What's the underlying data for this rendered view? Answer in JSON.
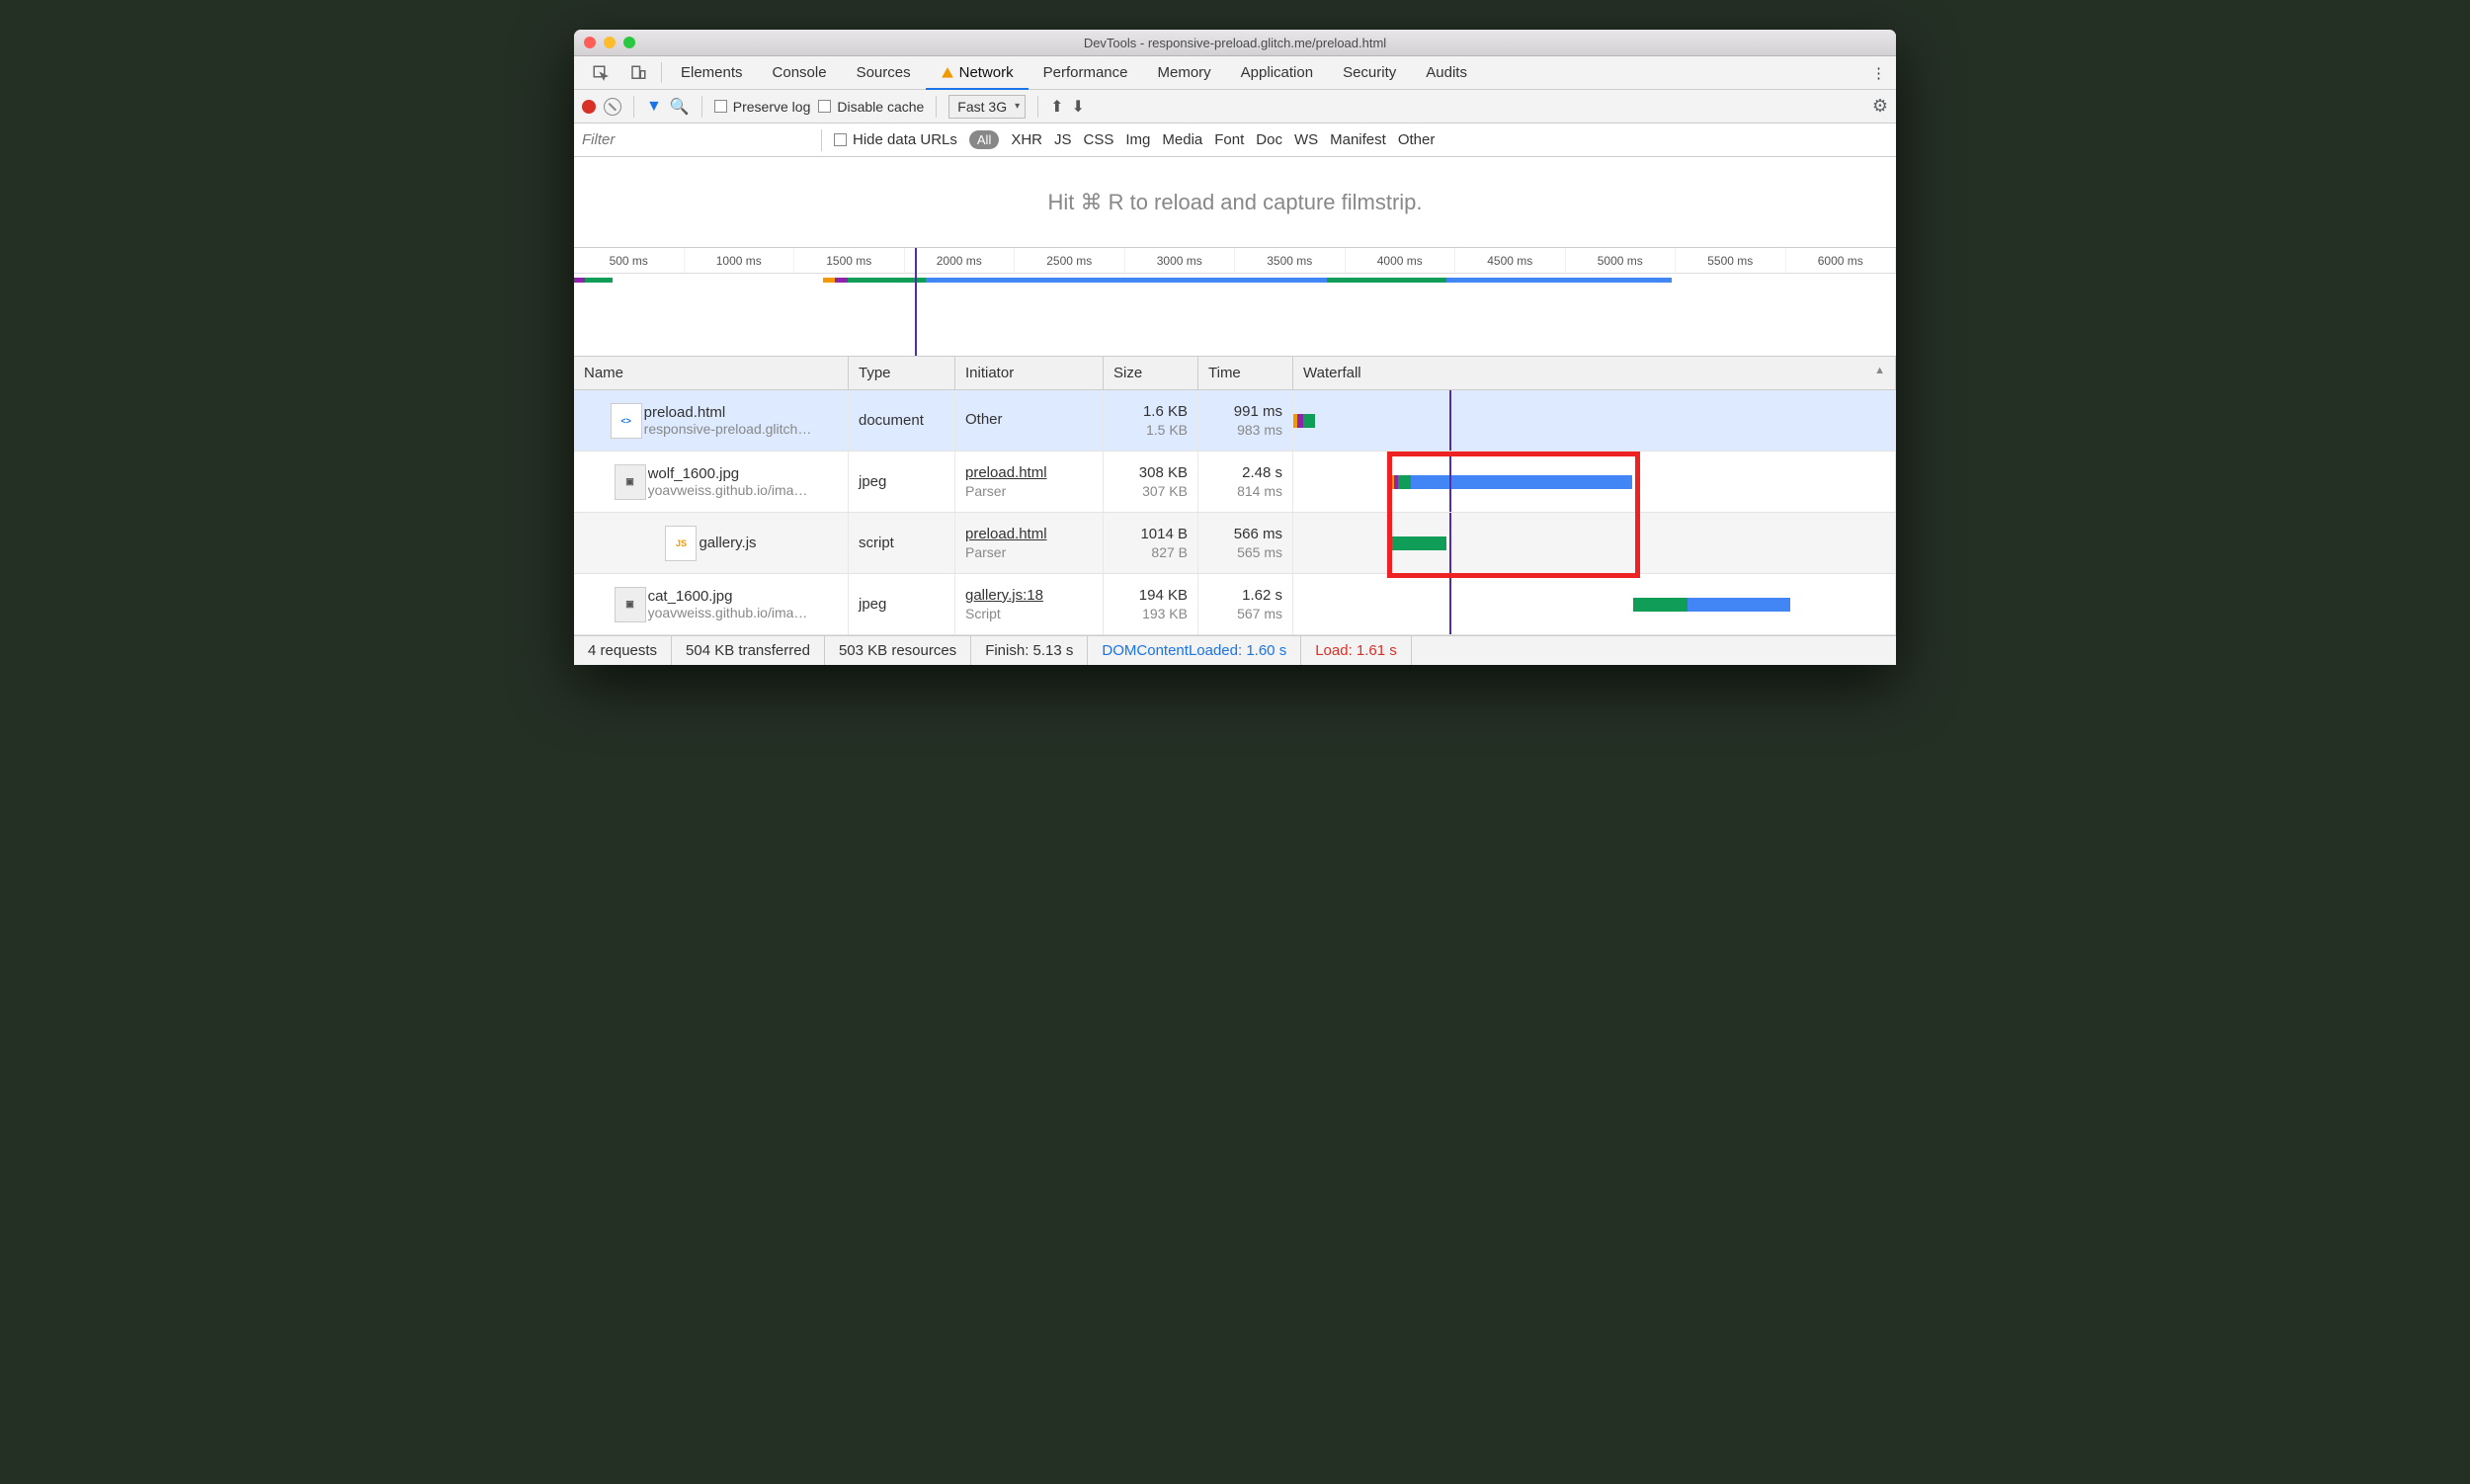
{
  "window_title": "DevTools - responsive-preload.glitch.me/preload.html",
  "tabs": [
    "Elements",
    "Console",
    "Sources",
    "Network",
    "Performance",
    "Memory",
    "Application",
    "Security",
    "Audits"
  ],
  "active_tab": "Network",
  "toolbar": {
    "preserve_log": "Preserve log",
    "disable_cache": "Disable cache",
    "throttling": "Fast 3G"
  },
  "filterbar": {
    "placeholder": "Filter",
    "hide_data_urls": "Hide data URLs",
    "all": "All",
    "types": [
      "XHR",
      "JS",
      "CSS",
      "Img",
      "Media",
      "Font",
      "Doc",
      "WS",
      "Manifest",
      "Other"
    ]
  },
  "hint": "Hit ⌘ R to reload and capture filmstrip.",
  "overview_ticks": [
    "500 ms",
    "1000 ms",
    "1500 ms",
    "2000 ms",
    "2500 ms",
    "3000 ms",
    "3500 ms",
    "4000 ms",
    "4500 ms",
    "5000 ms",
    "5500 ms",
    "6000 ms"
  ],
  "columns": {
    "name": "Name",
    "type": "Type",
    "initiator": "Initiator",
    "size": "Size",
    "time": "Time",
    "waterfall": "Waterfall"
  },
  "rows": [
    {
      "name": "preload.html",
      "sub": "responsive-preload.glitch…",
      "type": "document",
      "initiator": "Other",
      "initiator_sub": "",
      "size": "1.6 KB",
      "size_sub": "1.5 KB",
      "time": "991 ms",
      "time_sub": "983 ms",
      "icon": "doc"
    },
    {
      "name": "wolf_1600.jpg",
      "sub": "yoavweiss.github.io/ima…",
      "type": "jpeg",
      "initiator": "preload.html",
      "initiator_sub": "Parser",
      "size": "308 KB",
      "size_sub": "307 KB",
      "time": "2.48 s",
      "time_sub": "814 ms",
      "icon": "img"
    },
    {
      "name": "gallery.js",
      "sub": "",
      "type": "script",
      "initiator": "preload.html",
      "initiator_sub": "Parser",
      "size": "1014 B",
      "size_sub": "827 B",
      "time": "566 ms",
      "time_sub": "565 ms",
      "icon": "js"
    },
    {
      "name": "cat_1600.jpg",
      "sub": "yoavweiss.github.io/ima…",
      "type": "jpeg",
      "initiator": "gallery.js:18",
      "initiator_sub": "Script",
      "size": "194 KB",
      "size_sub": "193 KB",
      "time": "1.62 s",
      "time_sub": "567 ms",
      "icon": "img"
    }
  ],
  "status": {
    "requests": "4 requests",
    "transferred": "504 KB transferred",
    "resources": "503 KB resources",
    "finish": "Finish: 5.13 s",
    "dcl": "DOMContentLoaded: 1.60 s",
    "load": "Load: 1.61 s"
  },
  "chart_data": {
    "type": "gantt",
    "unit": "ms",
    "x_range": [
      0,
      6200
    ],
    "dom_content_loaded_ms": 1600,
    "load_event_ms": 1610,
    "series": [
      {
        "name": "preload.html",
        "start": 0,
        "segments": [
          {
            "color": "#f29900",
            "dur": 40
          },
          {
            "color": "#8e24aa",
            "dur": 60
          },
          {
            "color": "#0f9d58",
            "dur": 120
          }
        ]
      },
      {
        "name": "wolf_1600.jpg",
        "start": 1010,
        "segments": [
          {
            "color": "#f29900",
            "dur": 30
          },
          {
            "color": "#8e24aa",
            "dur": 40
          },
          {
            "color": "#0f9d58",
            "dur": 130
          },
          {
            "color": "#4285f4",
            "dur": 2280
          }
        ]
      },
      {
        "name": "gallery.js",
        "start": 1010,
        "segments": [
          {
            "color": "#0f9d58",
            "dur": 566
          }
        ]
      },
      {
        "name": "cat_1600.jpg",
        "start": 3500,
        "segments": [
          {
            "color": "#0f9d58",
            "dur": 560
          },
          {
            "color": "#4285f4",
            "dur": 1060
          }
        ]
      }
    ],
    "overview": [
      {
        "start": 0,
        "dur": 180,
        "color": "#0f9d58"
      },
      {
        "start": 0,
        "dur": 50,
        "color": "#8e24aa"
      },
      {
        "start": 1170,
        "dur": 55,
        "color": "#f29900"
      },
      {
        "start": 1225,
        "dur": 60,
        "color": "#8e24aa"
      },
      {
        "start": 1285,
        "dur": 400,
        "color": "#0f9d58"
      },
      {
        "start": 1650,
        "dur": 2400,
        "color": "#4285f4"
      },
      {
        "start": 3530,
        "dur": 560,
        "color": "#0f9d58"
      },
      {
        "start": 4090,
        "dur": 1060,
        "color": "#4285f4"
      }
    ],
    "highlight_box": true
  }
}
